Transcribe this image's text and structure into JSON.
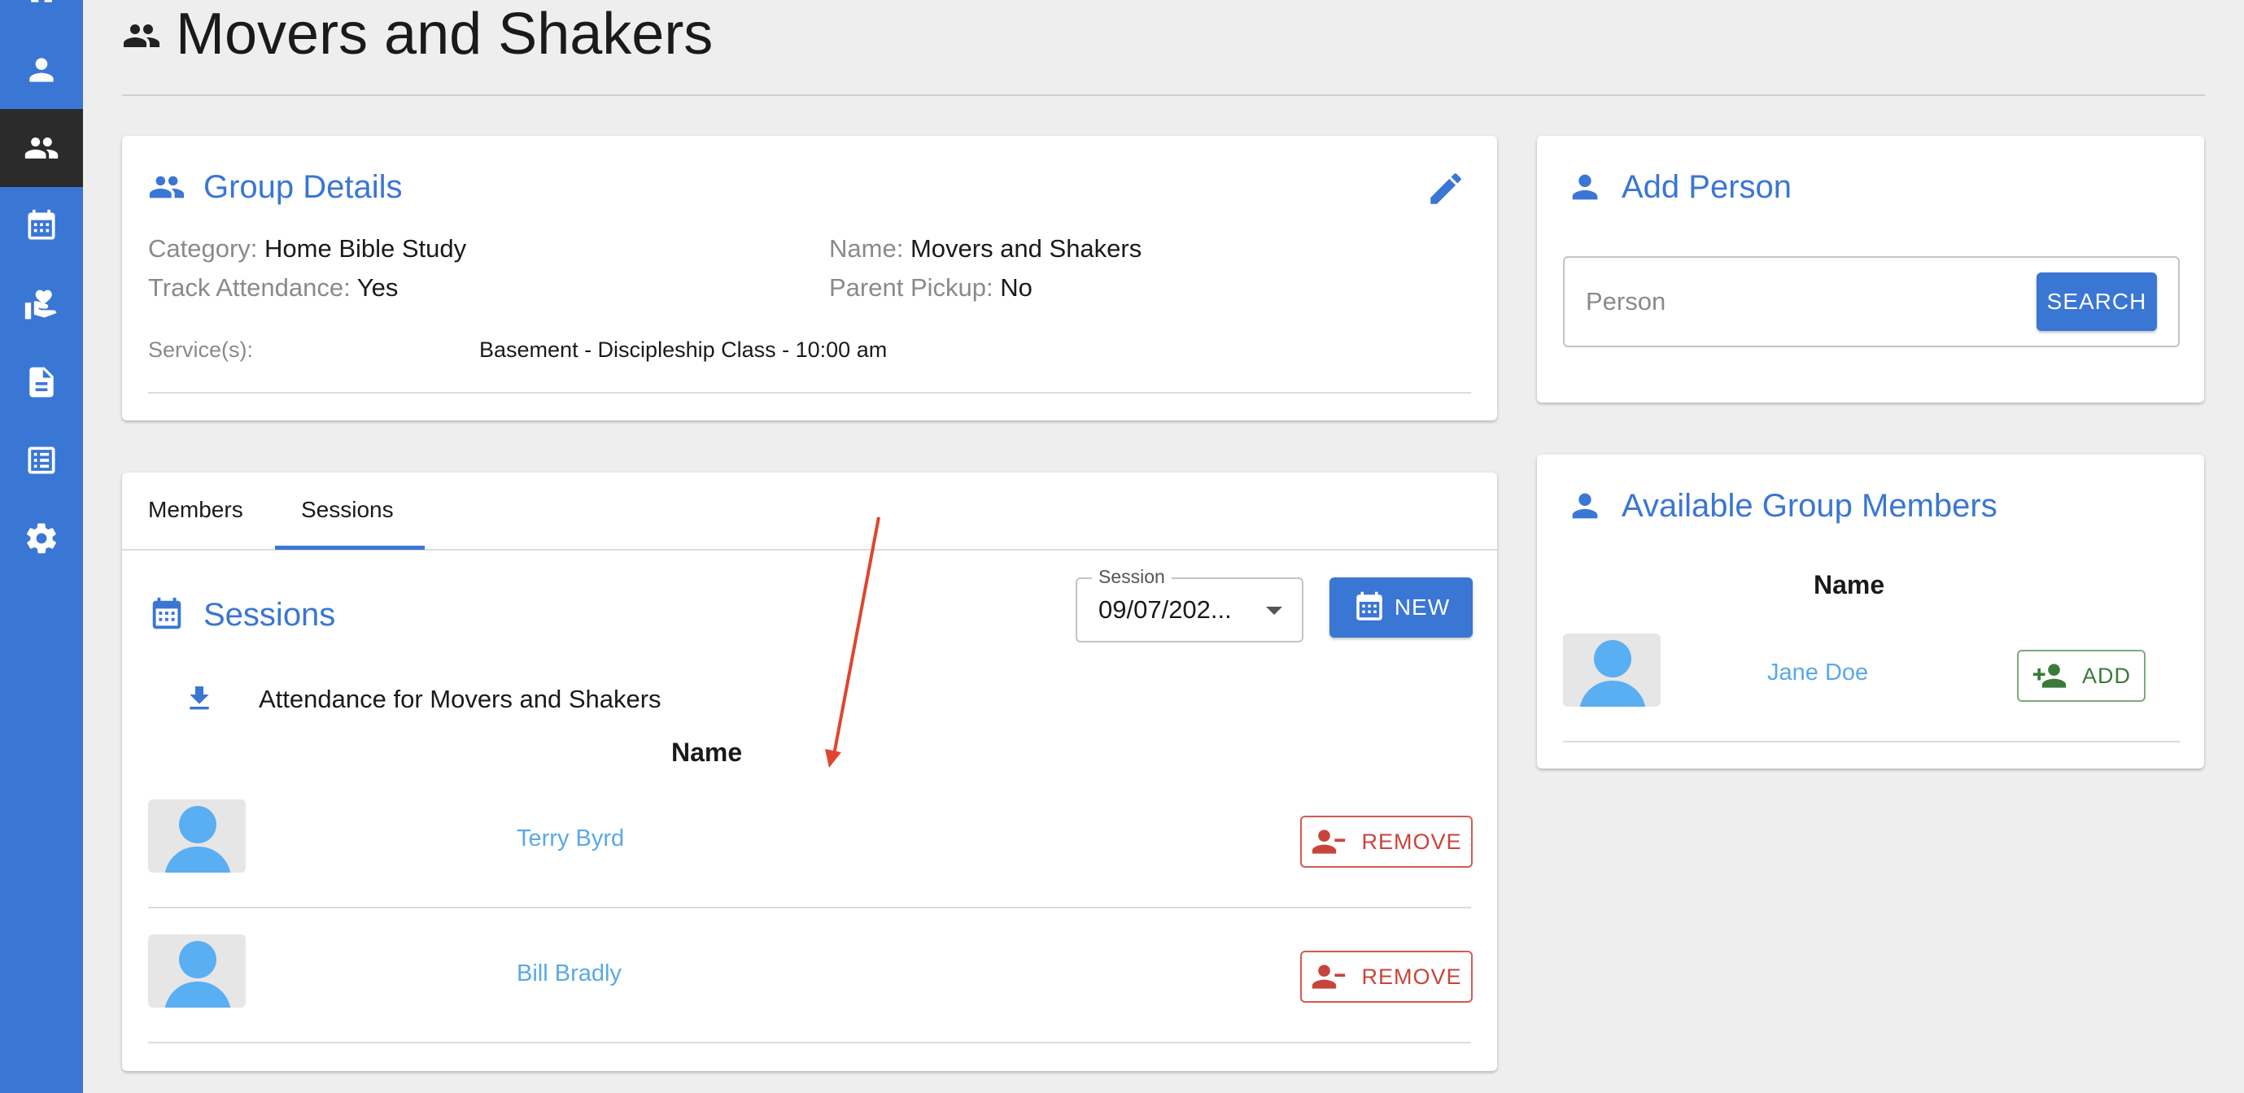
{
  "sidebar": {
    "items": [
      {
        "icon": "home-icon"
      },
      {
        "icon": "person-icon"
      },
      {
        "icon": "groups-icon",
        "active": true
      },
      {
        "icon": "calendar-icon"
      },
      {
        "icon": "donations-icon"
      },
      {
        "icon": "document-icon"
      },
      {
        "icon": "list-icon"
      },
      {
        "icon": "settings-icon"
      }
    ]
  },
  "header": {
    "title": "Movers and Shakers",
    "icon": "groups-icon"
  },
  "group_details": {
    "title": "Group Details",
    "category_label": "Category:",
    "category_value": "Home Bible Study",
    "track_label": "Track Attendance:",
    "track_value": "Yes",
    "name_label": "Name:",
    "name_value": "Movers and Shakers",
    "pickup_label": "Parent Pickup:",
    "pickup_value": "No",
    "services_label": "Service(s):",
    "services_value": "Basement - Discipleship Class - 10:00 am"
  },
  "tabs": {
    "members": "Members",
    "sessions": "Sessions",
    "active": "Sessions"
  },
  "sessions": {
    "title": "Sessions",
    "select_label": "Session",
    "select_value": "09/07/202...",
    "new_label": "NEW",
    "attendance_label": "Attendance for Movers and Shakers",
    "name_header": "Name",
    "rows": [
      {
        "name": "Terry Byrd",
        "action": "REMOVE"
      },
      {
        "name": "Bill Bradly",
        "action": "REMOVE"
      }
    ]
  },
  "add_person": {
    "title": "Add Person",
    "placeholder": "Person",
    "search_label": "SEARCH"
  },
  "available": {
    "title": "Available Group Members",
    "name_header": "Name",
    "rows": [
      {
        "name": "Jane Doe",
        "action": "ADD"
      }
    ]
  },
  "colors": {
    "accent": "#3a76d4",
    "remove": "#c8443b",
    "add": "#3c7a3c",
    "link": "#5aa9e6",
    "annotation_arrow": "#e0452f"
  }
}
